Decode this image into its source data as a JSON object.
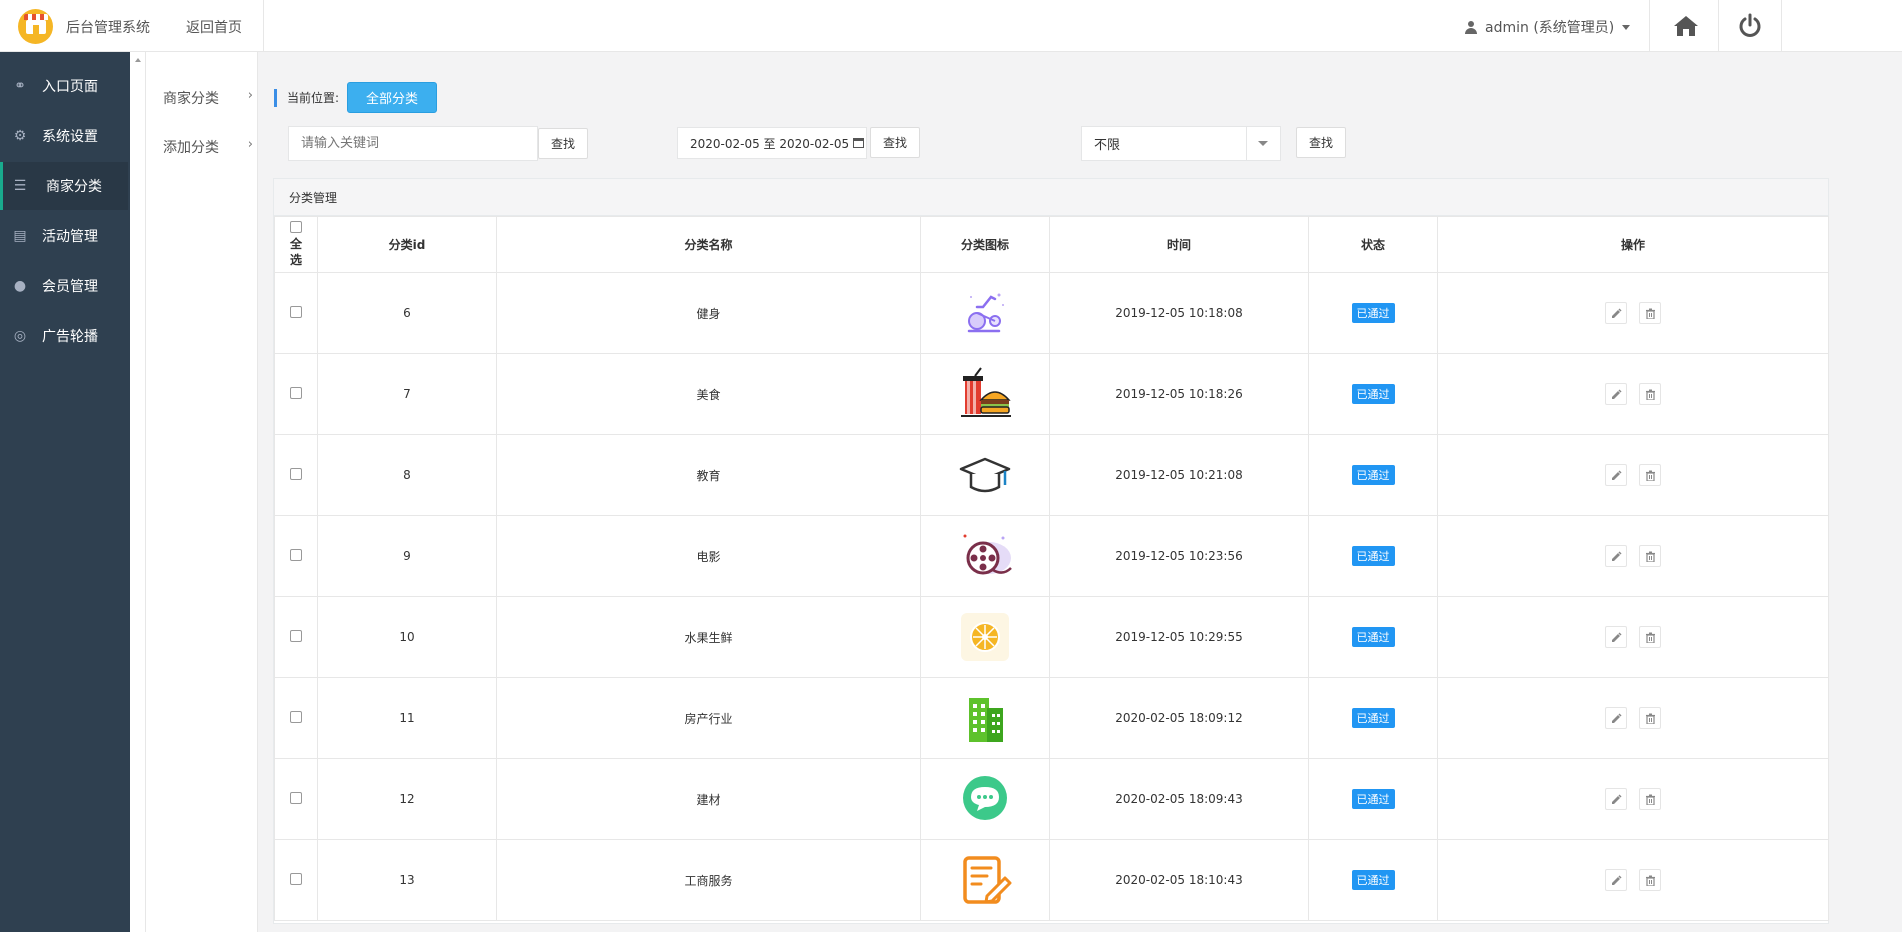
{
  "header": {
    "app_name": "后台管理系统",
    "back_home": "返回首页",
    "user": "admin (系统管理员)",
    "home_icon": "home-icon",
    "power_icon": "power-icon"
  },
  "sidebar": {
    "items": [
      {
        "label": "入口页面",
        "icon": "link-icon"
      },
      {
        "label": "系统设置",
        "icon": "gear-icon"
      },
      {
        "label": "商家分类",
        "icon": "list-icon",
        "active": true
      },
      {
        "label": "活动管理",
        "icon": "card-icon"
      },
      {
        "label": "会员管理",
        "icon": "user-icon"
      },
      {
        "label": "广告轮播",
        "icon": "lifebuoy-icon"
      }
    ]
  },
  "subnav": {
    "items": [
      {
        "label": "商家分类"
      },
      {
        "label": "添加分类"
      }
    ],
    "chevron": "›"
  },
  "breadcrumb": {
    "label": "当前位置:",
    "current": "全部分类"
  },
  "filters": {
    "keyword_placeholder": "请输入关键词",
    "search_label": "查找",
    "date_range": "2020-02-05 至 2020-02-05",
    "status_select": "不限"
  },
  "panel": {
    "title": "分类管理"
  },
  "table": {
    "select_all": [
      "全",
      "选"
    ],
    "headers": [
      "分类id",
      "分类名称",
      "分类图标",
      "时间",
      "状态",
      "操作"
    ],
    "rows": [
      {
        "id": "6",
        "name": "健身",
        "icon": "exercise-bike-icon",
        "time": "2019-12-05 10:18:08",
        "status": "已通过"
      },
      {
        "id": "7",
        "name": "美食",
        "icon": "burger-drink-icon",
        "time": "2019-12-05 10:18:26",
        "status": "已通过"
      },
      {
        "id": "8",
        "name": "教育",
        "icon": "graduation-cap-icon",
        "time": "2019-12-05 10:21:08",
        "status": "已通过"
      },
      {
        "id": "9",
        "name": "电影",
        "icon": "film-reel-icon",
        "time": "2019-12-05 10:23:56",
        "status": "已通过"
      },
      {
        "id": "10",
        "name": "水果生鲜",
        "icon": "orange-slice-icon",
        "time": "2019-12-05 10:29:55",
        "status": "已通过"
      },
      {
        "id": "11",
        "name": "房产行业",
        "icon": "building-icon",
        "time": "2020-02-05 18:09:12",
        "status": "已通过"
      },
      {
        "id": "12",
        "name": "建材",
        "icon": "chat-bubble-icon",
        "time": "2020-02-05 18:09:43",
        "status": "已通过"
      },
      {
        "id": "13",
        "name": "工商服务",
        "icon": "document-edit-icon",
        "time": "2020-02-05 18:10:43",
        "status": "已通过"
      }
    ]
  },
  "colors": {
    "sidebar_bg": "#2f4050",
    "accent": "#3cafef",
    "badge": "#2196f3"
  }
}
